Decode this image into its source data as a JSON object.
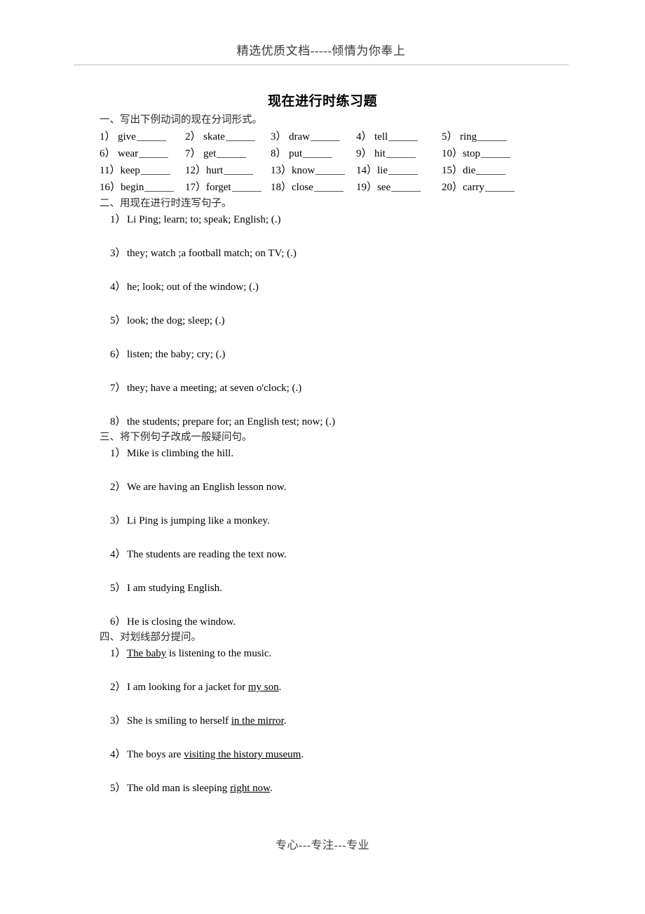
{
  "document": {
    "running_header": "精选优质文档-----倾情为你奉上",
    "title": "现在进行时练习题",
    "footer": "专心---专注---专业"
  },
  "sections": [
    {
      "heading": "一、写出下例动词的现在分词形式。",
      "type": "verb-blanks",
      "items": [
        {
          "num": "1）",
          "word": "give"
        },
        {
          "num": "2）",
          "word": "skate"
        },
        {
          "num": "3）",
          "word": "draw"
        },
        {
          "num": "4）",
          "word": "tell"
        },
        {
          "num": "5）",
          "word": "ring"
        },
        {
          "num": "6）",
          "word": "wear"
        },
        {
          "num": "7）",
          "word": "get"
        },
        {
          "num": "8）",
          "word": "put"
        },
        {
          "num": "9）",
          "word": "hit"
        },
        {
          "num": "10）",
          "word": "stop"
        },
        {
          "num": "11）",
          "word": "keep"
        },
        {
          "num": "12）",
          "word": "hurt"
        },
        {
          "num": "13）",
          "word": "know"
        },
        {
          "num": "14）",
          "word": "lie"
        },
        {
          "num": "15）",
          "word": "die"
        },
        {
          "num": "16）",
          "word": "begin"
        },
        {
          "num": "17）",
          "word": "forget"
        },
        {
          "num": "18）",
          "word": "close"
        },
        {
          "num": "19）",
          "word": "see"
        },
        {
          "num": "20）",
          "word": "carry"
        }
      ]
    },
    {
      "heading": "二、用现在进行时连写句子。",
      "type": "sentences",
      "items": [
        {
          "num": "1）",
          "text": "Li Ping; learn; to; speak; English; (.)"
        },
        {
          "num": "3）",
          "text": "they; watch ;a football match; on TV; (.)"
        },
        {
          "num": "4）",
          "text": "he; look; out of the window; (.)"
        },
        {
          "num": "5）",
          "text": "look; the dog; sleep; (.)"
        },
        {
          "num": "6）",
          "text": "listen; the baby; cry; (.)"
        },
        {
          "num": "7）",
          "text": "they; have a meeting; at seven o'clock; (.)"
        },
        {
          "num": "8）",
          "text": "the students; prepare for; an English test; now; (.)"
        }
      ]
    },
    {
      "heading": "三、将下例句子改成一般疑问句。",
      "type": "sentences",
      "items": [
        {
          "num": "1）",
          "text": "Mike is climbing the hill."
        },
        {
          "num": "2）",
          "text": "We are having an English lesson now."
        },
        {
          "num": "3）",
          "text": "Li Ping is jumping like a monkey."
        },
        {
          "num": "4）",
          "text": "The students are reading the text now."
        },
        {
          "num": "5）",
          "text": "I am studying English."
        },
        {
          "num": "6）",
          "text": "He is closing the window."
        }
      ]
    },
    {
      "heading": "四、对划线部分提问。",
      "type": "underlined-sentences",
      "items": [
        {
          "num": "1）",
          "before": "",
          "underlined": "The baby",
          "after": " is listening to the music."
        },
        {
          "num": "2）",
          "before": "I am looking for a jacket for ",
          "underlined": "my son",
          "after": "."
        },
        {
          "num": "3）",
          "before": "She is smiling to herself ",
          "underlined": "in the mirror",
          "after": "."
        },
        {
          "num": "4）",
          "before": "The boys are ",
          "underlined": "visiting the history museum",
          "after": "."
        },
        {
          "num": "5）",
          "before": "The old man is sleeping ",
          "underlined": "right now",
          "after": "."
        }
      ]
    }
  ]
}
